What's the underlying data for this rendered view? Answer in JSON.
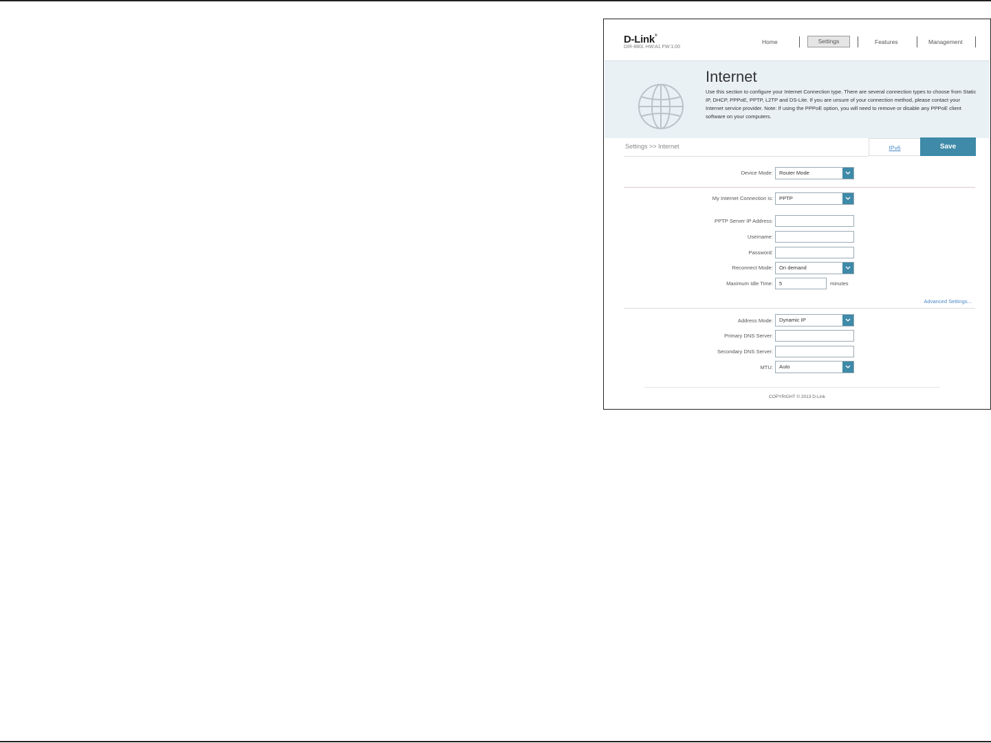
{
  "header": {
    "logo": "D-Link",
    "model": "DIR-880L   HW:A1   FW:1.00",
    "nav": [
      "Home",
      "Settings",
      "Features",
      "Management"
    ],
    "active_tab": "Settings"
  },
  "banner": {
    "title": "Internet",
    "description": "Use this section to configure your Internet Connection type. There are several connection types to choose from Static IP, DHCP, PPPoE, PPTP, L2TP and DS-Lite. If you are unsure of your connection method, please contact your Internet service provider. Note: If using the PPPoE option, you will need to remove or disable any PPPoE client software on your computers.",
    "icon": "globe-icon"
  },
  "toolbar": {
    "breadcrumb": "Settings >> Internet",
    "ipv6_label": "IPv6",
    "save_label": "Save"
  },
  "form": {
    "device_mode_label": "Device Mode:",
    "device_mode_value": "Router Mode",
    "connection_label": "My Internet Connection is:",
    "connection_value": "PPTP",
    "pptp_server_label": "PPTP Server IP Address:",
    "pptp_server_value": "",
    "username_label": "Username:",
    "username_value": "",
    "password_label": "Password:",
    "password_value": "",
    "reconnect_label": "Reconnect Mode:",
    "reconnect_value": "On demand",
    "idle_label": "Maximum Idle Time:",
    "idle_value": "5",
    "idle_unit": "minutes",
    "advanced_link": "Advanced Settings...",
    "address_mode_label": "Address Mode:",
    "address_mode_value": "Dynamic IP",
    "primary_dns_label": "Primary DNS Server:",
    "primary_dns_value": "",
    "secondary_dns_label": "Secondary DNS Server:",
    "secondary_dns_value": "",
    "mtu_label": "MTU:",
    "mtu_value": "Auto"
  },
  "footer": {
    "copyright": "COPYRIGHT © 2013 D-Link"
  },
  "colors": {
    "accent": "#3e8aa8",
    "banner_bg": "#e9f1f5",
    "link": "#4a89c8"
  }
}
